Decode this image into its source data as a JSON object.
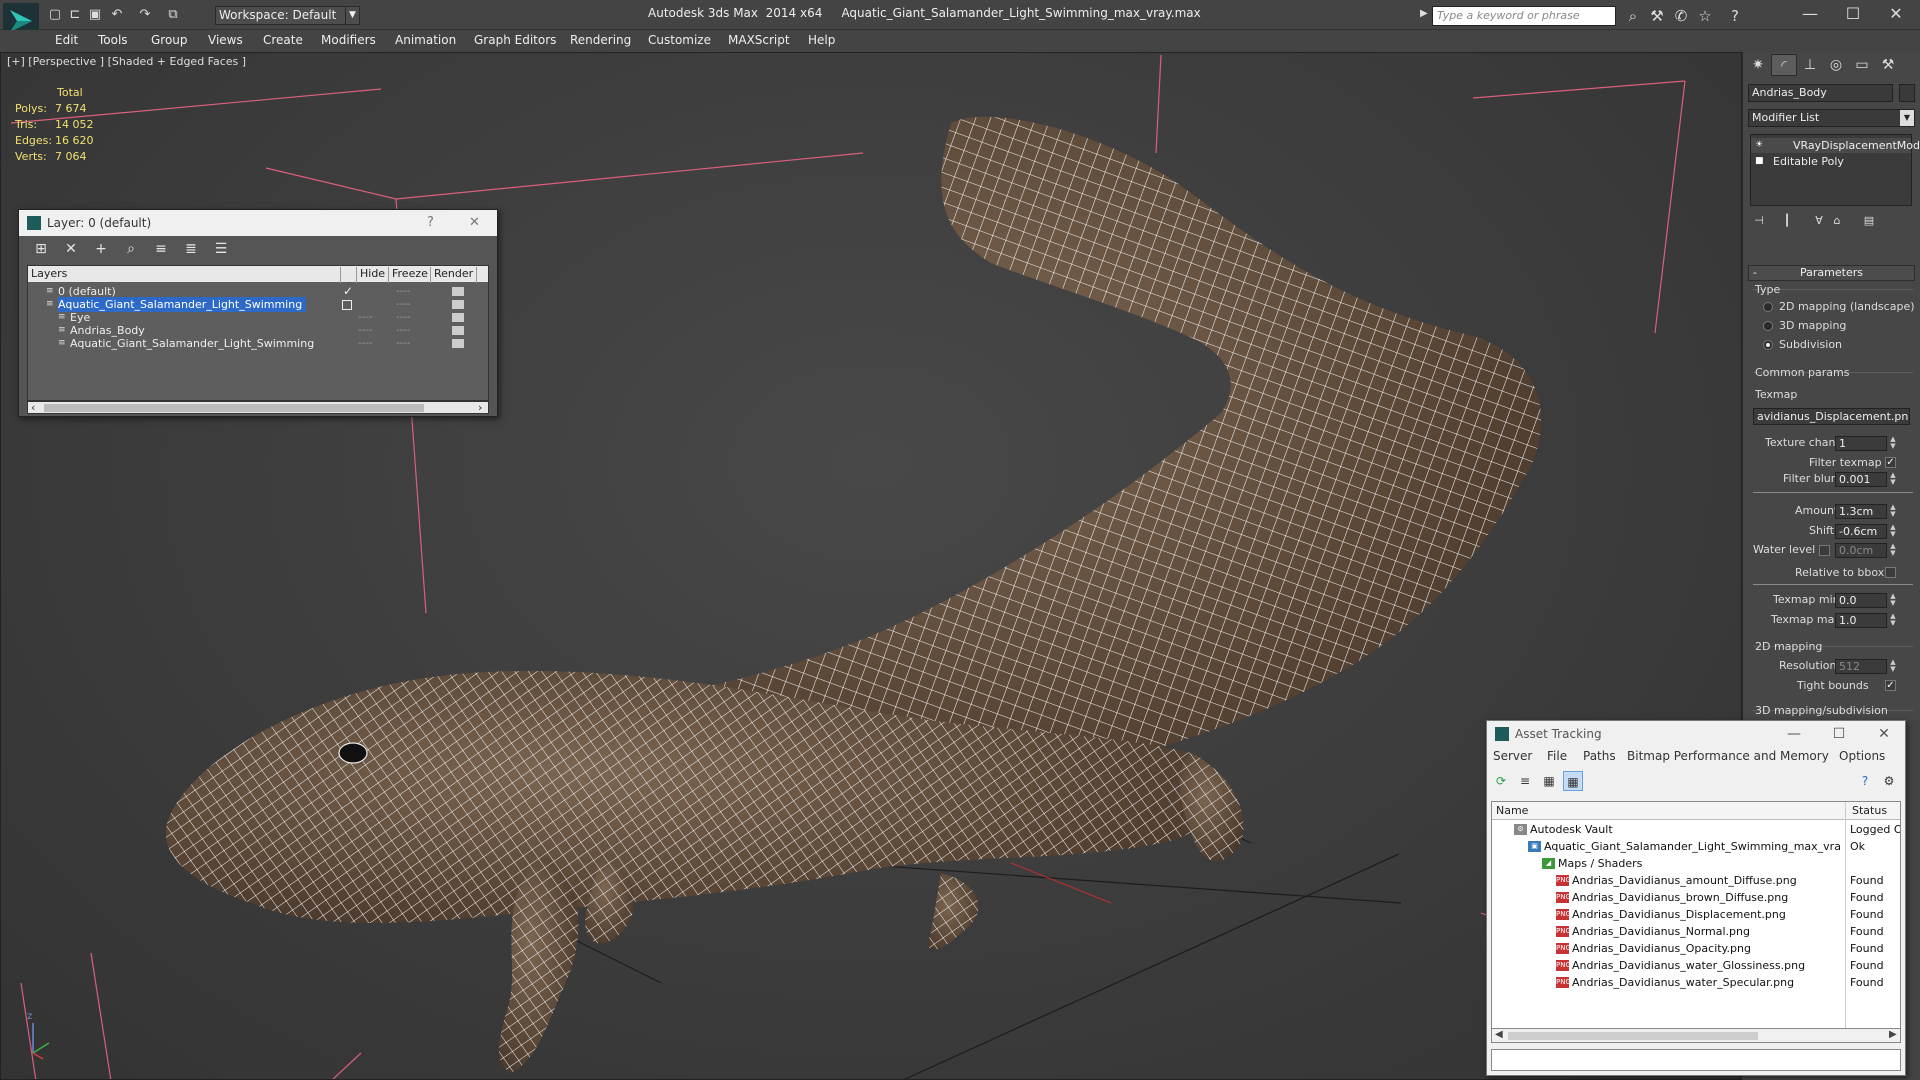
{
  "titlebar": {
    "workspace": "Workspace: Default",
    "app_name": "Autodesk 3ds Max  2014 x64",
    "file_name": "Aquatic_Giant_Salamander_Light_Swimming_max_vray.max",
    "search_placeholder": "Type a keyword or phrase"
  },
  "menu": [
    "Edit",
    "Tools",
    "Group",
    "Views",
    "Create",
    "Modifiers",
    "Animation",
    "Graph Editors",
    "Rendering",
    "Customize",
    "MAXScript",
    "Help"
  ],
  "viewport": {
    "label": "[+] [Perspective ] [Shaded + Edged Faces ]",
    "stats": {
      "header": "Total",
      "rows": [
        {
          "label": "Polys:",
          "value": "7 674"
        },
        {
          "label": "Tris:",
          "value": "14 052"
        },
        {
          "label": "Edges:",
          "value": "16 620"
        },
        {
          "label": "Verts:",
          "value": "7 064"
        }
      ]
    }
  },
  "layer_dialog": {
    "title": "Layer: 0 (default)",
    "help": "?",
    "close": "✕",
    "columns": {
      "layers": "Layers",
      "hide": "Hide",
      "freeze": "Freeze",
      "render": "Render"
    },
    "rows": [
      {
        "name": "0 (default)",
        "indent": 0,
        "hide": "✓",
        "freeze": "----",
        "selected": false
      },
      {
        "name": "Aquatic_Giant_Salamander_Light_Swimming",
        "indent": 0,
        "hide": "",
        "freeze": "----",
        "selected": true
      },
      {
        "name": "Eye",
        "indent": 1,
        "hide": "----",
        "freeze": "----",
        "selected": false
      },
      {
        "name": "Andrias_Body",
        "indent": 1,
        "hide": "----",
        "freeze": "----",
        "selected": false
      },
      {
        "name": "Aquatic_Giant_Salamander_Light_Swimming",
        "indent": 1,
        "hide": "----",
        "freeze": "----",
        "selected": false
      }
    ]
  },
  "command_panel": {
    "object_name": "Andrias_Body",
    "modifier_list": "Modifier List",
    "stack": [
      {
        "name": "VRayDisplacementMod",
        "selected": true
      },
      {
        "name": "Editable Poly",
        "selected": false
      }
    ],
    "parameters": {
      "title": "Parameters",
      "type_label": "Type",
      "type_options": [
        {
          "label": "2D mapping (landscape)",
          "on": false
        },
        {
          "label": "3D mapping",
          "on": false
        },
        {
          "label": "Subdivision",
          "on": true
        }
      ],
      "common_params_label": "Common params",
      "texmap_label": "Texmap",
      "texmap_value": "avidianus_Displacement.png)",
      "texture_chan_label": "Texture chan",
      "texture_chan_value": "1",
      "filter_texmap_label": "Filter texmap",
      "filter_blur_label": "Filter blur",
      "filter_blur_value": "0.001",
      "amount_label": "Amount",
      "amount_value": "1.3cm",
      "shift_label": "Shift",
      "shift_value": "-0.6cm",
      "water_level_label": "Water level",
      "water_level_value": "0.0cm",
      "relative_bbox_label": "Relative to bbox",
      "texmap_min_label": "Texmap min",
      "texmap_min_value": "0.0",
      "texmap_max_label": "Texmap max",
      "texmap_max_value": "1.0",
      "mapping_2d_label": "2D mapping",
      "resolution_label": "Resolution",
      "resolution_value": "512",
      "tight_bounds_label": "Tight bounds",
      "mapping_3d_label": "3D mapping/subdivision"
    }
  },
  "asset_tracking": {
    "title": "Asset Tracking",
    "menu": [
      "Server",
      "File",
      "Paths",
      "Bitmap Performance and Memory",
      "Options"
    ],
    "columns": {
      "name": "Name",
      "status": "Status"
    },
    "rows": [
      {
        "name": "Autodesk Vault",
        "status": "Logged O",
        "indent": 0,
        "icon": "vault"
      },
      {
        "name": "Aquatic_Giant_Salamander_Light_Swimming_max_vray...",
        "status": "Ok",
        "indent": 1,
        "icon": "max"
      },
      {
        "name": "Maps / Shaders",
        "status": "",
        "indent": 2,
        "icon": "maps"
      },
      {
        "name": "Andrias_Davidianus_amount_Diffuse.png",
        "status": "Found",
        "indent": 3,
        "icon": "png"
      },
      {
        "name": "Andrias_Davidianus_brown_Diffuse.png",
        "status": "Found",
        "indent": 3,
        "icon": "png"
      },
      {
        "name": "Andrias_Davidianus_Displacement.png",
        "status": "Found",
        "indent": 3,
        "icon": "png"
      },
      {
        "name": "Andrias_Davidianus_Normal.png",
        "status": "Found",
        "indent": 3,
        "icon": "png"
      },
      {
        "name": "Andrias_Davidianus_Opacity.png",
        "status": "Found",
        "indent": 3,
        "icon": "png"
      },
      {
        "name": "Andrias_Davidianus_water_Glossiness.png",
        "status": "Found",
        "indent": 3,
        "icon": "png"
      },
      {
        "name": "Andrias_Davidianus_water_Specular.png",
        "status": "Found",
        "indent": 3,
        "icon": "png"
      }
    ]
  },
  "colors": {
    "ui_bg": "#444444",
    "selection_blue": "#2d6ac8",
    "stats_yellow": "#f0e070",
    "bbox_pink": "#e0607a",
    "mesh_brown": "#5c4a3a"
  }
}
